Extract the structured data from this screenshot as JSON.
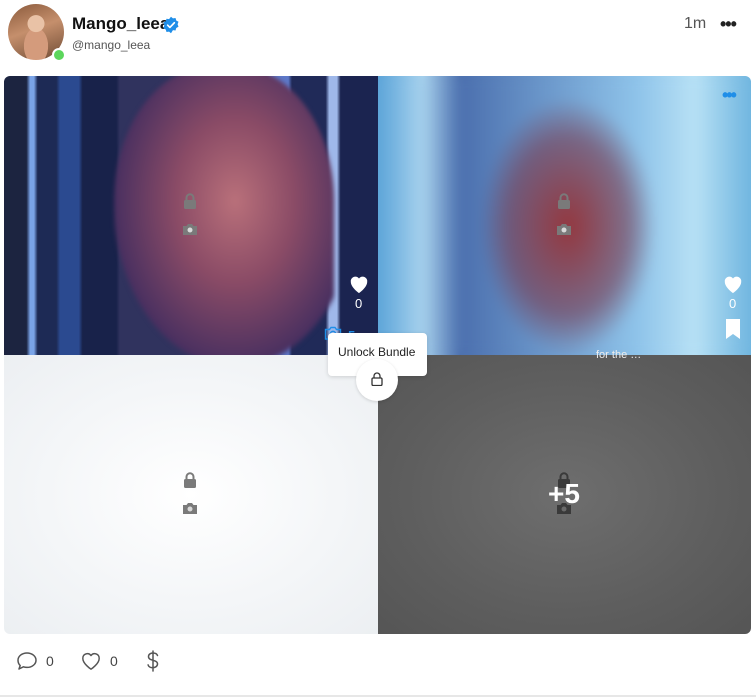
{
  "post": {
    "author_name": "Mango_leea",
    "author_handle": "@mango_leea",
    "time_ago": "1m",
    "more_glyph": "•••"
  },
  "media": {
    "camera_count": "5",
    "extra_count": "+5",
    "tile2_likes": "0",
    "tile1_likes": "0",
    "blue_dots": "•••",
    "faint_text": "for the …"
  },
  "bundle": {
    "tooltip_label": "Unlock Bundle"
  },
  "footer": {
    "comments_count": "0",
    "likes_count": "0"
  },
  "colors": {
    "accent": "#1f8ee8",
    "online": "#5cd65c"
  },
  "icons": [
    "verified-badge-icon",
    "more-icon",
    "lock-icon",
    "camera-icon",
    "heart-icon",
    "bookmark-icon",
    "comment-icon",
    "dollar-icon"
  ]
}
